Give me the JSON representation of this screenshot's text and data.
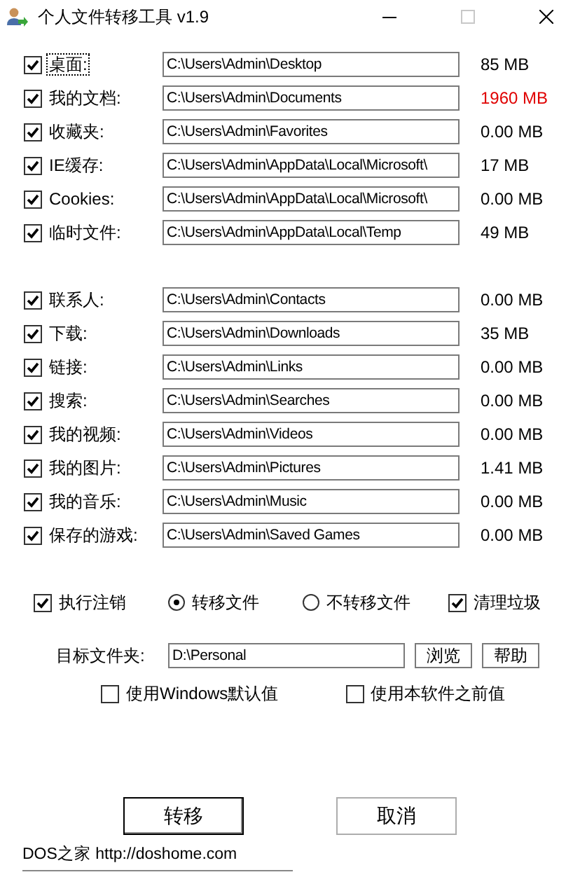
{
  "window": {
    "title": "个人文件转移工具 v1.9"
  },
  "folder_groups": [
    [
      {
        "label": "桌面:",
        "path": "C:\\Users\\Admin\\Desktop",
        "size": "85 MB",
        "checked": true,
        "warning": false,
        "focused": true
      },
      {
        "label": "我的文档:",
        "path": "C:\\Users\\Admin\\Documents",
        "size": "1960 MB",
        "checked": true,
        "warning": true,
        "focused": false
      },
      {
        "label": "收藏夹:",
        "path": "C:\\Users\\Admin\\Favorites",
        "size": "0.00 MB",
        "checked": true,
        "warning": false,
        "focused": false
      },
      {
        "label": "IE缓存:",
        "path": "C:\\Users\\Admin\\AppData\\Local\\Microsoft\\",
        "size": "17 MB",
        "checked": true,
        "warning": false,
        "focused": false
      },
      {
        "label": "Cookies:",
        "path": "C:\\Users\\Admin\\AppData\\Local\\Microsoft\\",
        "size": "0.00 MB",
        "checked": true,
        "warning": false,
        "focused": false
      },
      {
        "label": "临时文件:",
        "path": "C:\\Users\\Admin\\AppData\\Local\\Temp",
        "size": "49 MB",
        "checked": true,
        "warning": false,
        "focused": false
      }
    ],
    [
      {
        "label": "联系人:",
        "path": "C:\\Users\\Admin\\Contacts",
        "size": "0.00 MB",
        "checked": true,
        "warning": false,
        "focused": false
      },
      {
        "label": "下载:",
        "path": "C:\\Users\\Admin\\Downloads",
        "size": "35 MB",
        "checked": true,
        "warning": false,
        "focused": false
      },
      {
        "label": "链接:",
        "path": "C:\\Users\\Admin\\Links",
        "size": "0.00 MB",
        "checked": true,
        "warning": false,
        "focused": false
      },
      {
        "label": "搜索:",
        "path": "C:\\Users\\Admin\\Searches",
        "size": "0.00 MB",
        "checked": true,
        "warning": false,
        "focused": false
      },
      {
        "label": "我的视频:",
        "path": "C:\\Users\\Admin\\Videos",
        "size": "0.00 MB",
        "checked": true,
        "warning": false,
        "focused": false
      },
      {
        "label": "我的图片:",
        "path": "C:\\Users\\Admin\\Pictures",
        "size": "1.41 MB",
        "checked": true,
        "warning": false,
        "focused": false
      },
      {
        "label": "我的音乐:",
        "path": "C:\\Users\\Admin\\Music",
        "size": "0.00 MB",
        "checked": true,
        "warning": false,
        "focused": false
      },
      {
        "label": "保存的游戏:",
        "path": "C:\\Users\\Admin\\Saved Games",
        "size": "0.00 MB",
        "checked": true,
        "warning": false,
        "focused": false
      }
    ]
  ],
  "options": [
    {
      "kind": "checkbox",
      "label": "执行注销",
      "checked": true
    },
    {
      "kind": "radio",
      "label": "转移文件",
      "selected": true
    },
    {
      "kind": "radio",
      "label": "不转移文件",
      "selected": false
    },
    {
      "kind": "checkbox",
      "label": "清理垃圾",
      "checked": true
    }
  ],
  "target": {
    "label": "目标文件夹:",
    "value": "D:\\Personal",
    "buttons": [
      "浏览",
      "帮助"
    ]
  },
  "defaults": [
    {
      "label": "使用Windows默认值",
      "checked": false
    },
    {
      "label": "使用本软件之前值",
      "checked": false
    }
  ],
  "actions": [
    "转移",
    "取消"
  ],
  "footer": "DOS之家 http://doshome.com"
}
